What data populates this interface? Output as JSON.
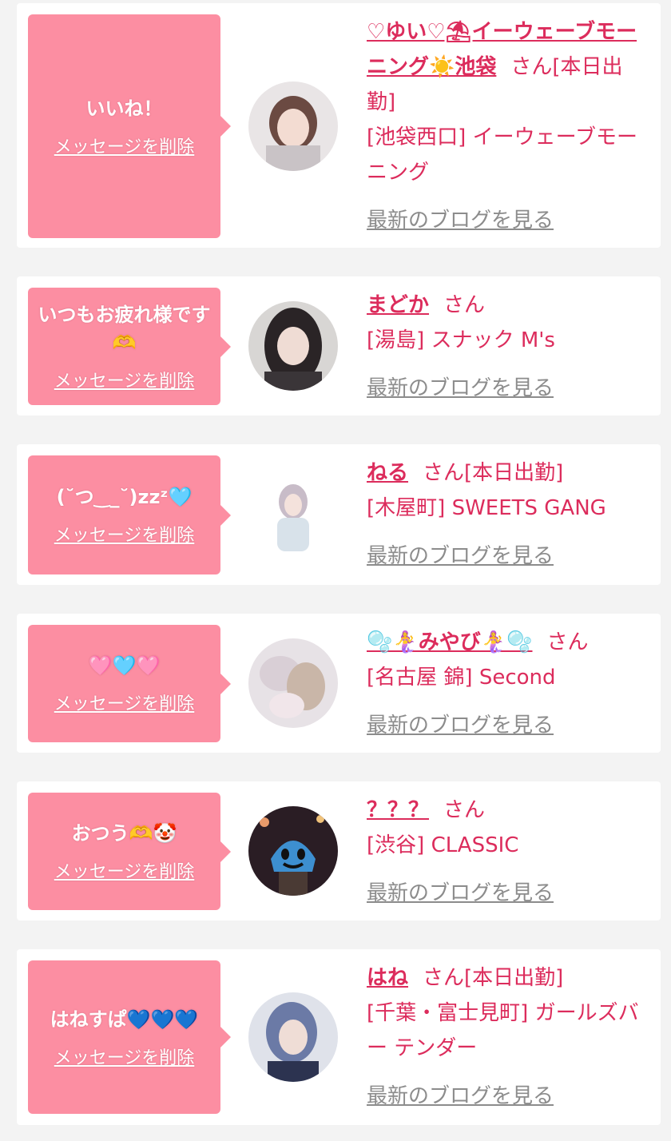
{
  "delete_label": "メッセージを削除",
  "blog_label": "最新のブログを見る",
  "san_label": "さん",
  "cards": [
    {
      "message": "いいね！",
      "name": "♡ゆい♡⛱イーウェーブモーニング☀️池袋",
      "status": "[本日出勤]",
      "area": "[池袋西口]",
      "shop": "イーウェーブモーニング"
    },
    {
      "message": "いつもお疲れ様です🫶",
      "name": "まどか",
      "status": "",
      "area": "[湯島]",
      "shop": "スナック M's"
    },
    {
      "message": "(˘つ‿_˘)zzᶻ🩵",
      "name": "ねる",
      "status": "[本日出勤]",
      "area": "[木屋町]",
      "shop": "SWEETS GANG"
    },
    {
      "message": "🩷🩵🩷",
      "name": "🫧🧜‍♀️みやび🧜‍♀️🫧",
      "status": "",
      "area": "[名古屋 錦]",
      "shop": "Second"
    },
    {
      "message": "おつう🫶🤡",
      "name": "？？？",
      "status": "",
      "area": "[渋谷]",
      "shop": "CLASSIC"
    },
    {
      "message": "はねすぱ💙💙💙",
      "name": "はね",
      "status": "[本日出勤]",
      "area": "[千葉・富士見町]",
      "shop": "ガールズバー テンダー"
    }
  ],
  "colors": {
    "bubble": "#fc8ea2",
    "accent": "#dc2c5c",
    "link_gray": "#8c8c8c",
    "background": "#f3f3f3"
  }
}
